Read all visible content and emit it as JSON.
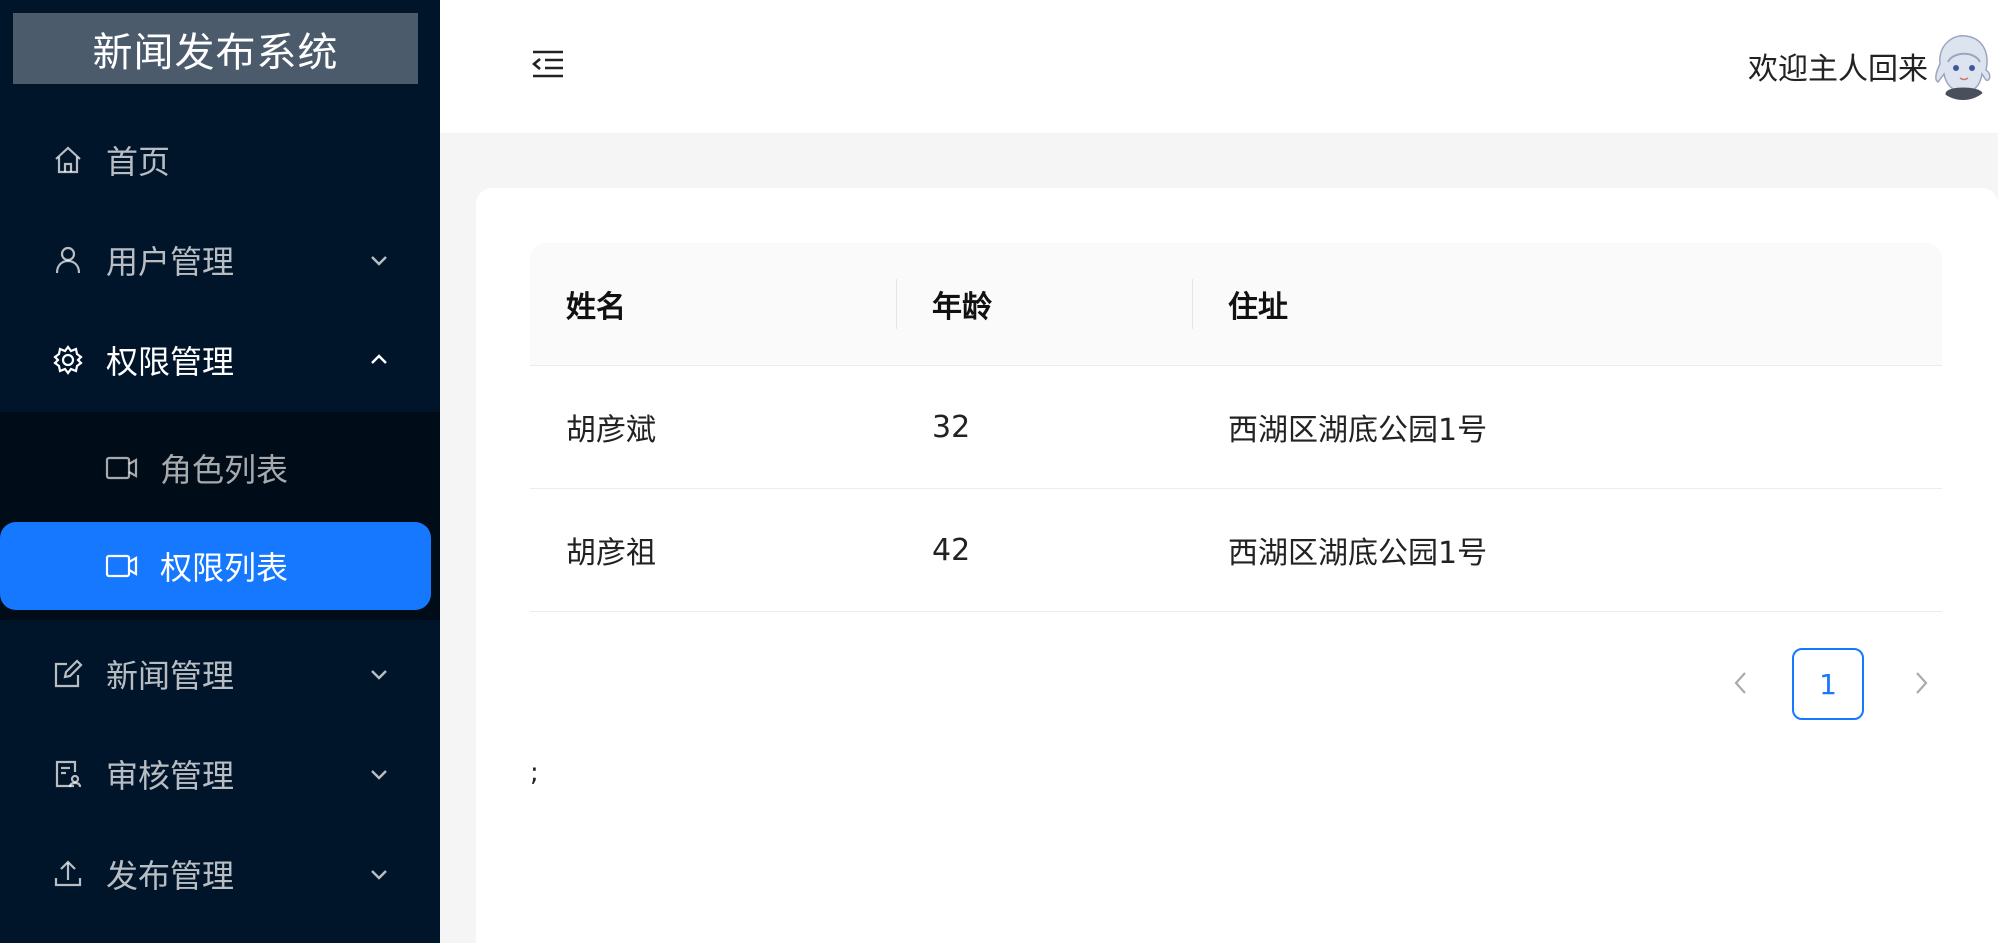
{
  "app": {
    "title": "新闻发布系统"
  },
  "sidebar": {
    "items": [
      {
        "label": "首页",
        "icon": "home-icon"
      },
      {
        "label": "用户管理",
        "icon": "user-icon"
      },
      {
        "label": "权限管理",
        "icon": "gear-icon"
      },
      {
        "label": "新闻管理",
        "icon": "edit-icon"
      },
      {
        "label": "审核管理",
        "icon": "audit-icon"
      },
      {
        "label": "发布管理",
        "icon": "upload-icon"
      }
    ],
    "submenu": [
      {
        "label": "角色列表",
        "icon": "video-icon"
      },
      {
        "label": "权限列表",
        "icon": "video-icon"
      }
    ]
  },
  "header": {
    "welcome": "欢迎主人回来"
  },
  "table": {
    "columns": [
      "姓名",
      "年龄",
      "住址"
    ],
    "rows": [
      [
        "胡彦斌",
        "32",
        "西湖区湖底公园1号"
      ],
      [
        "胡彦祖",
        "42",
        "西湖区湖底公园1号"
      ]
    ]
  },
  "pagination": {
    "current": "1"
  },
  "stray_text": ";",
  "colors": {
    "sidebar": "#001529",
    "active": "#1677ff",
    "submenu": "#000c17"
  }
}
